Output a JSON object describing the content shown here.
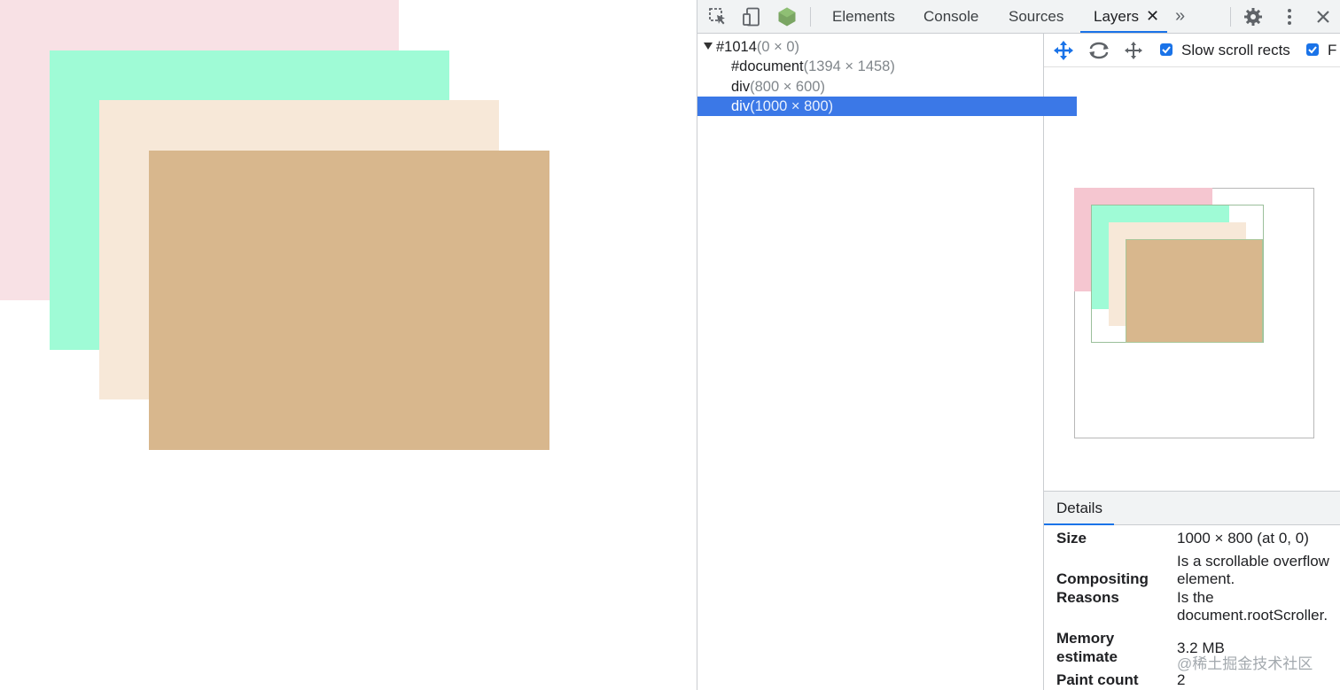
{
  "colors": {
    "box1": "#f8e1e5",
    "box2": "#9ffbd6",
    "box3": "#f7e8d8",
    "box4": "#d8b78d",
    "accent": "#1a73e8",
    "selection": "#3b78e7"
  },
  "toolbar": {
    "icons": [
      "inspect-icon",
      "device-toggle-icon",
      "vue-devtools-icon"
    ],
    "tabs": {
      "elements": "Elements",
      "console": "Console",
      "sources": "Sources",
      "layers": "Layers"
    },
    "active_tab": "Layers",
    "close_tab_glyph": "✕",
    "more_tabs_glyph": "»",
    "right_icons": [
      "settings-gear-icon",
      "more-vertical-icon",
      "close-icon"
    ]
  },
  "layer_tree": {
    "rows": [
      {
        "name": "#1014",
        "dims": "(0 × 0)",
        "expanded": true,
        "selected": false
      },
      {
        "name": "#document",
        "dims": "(1394 × 1458)",
        "selected": false
      },
      {
        "name": "div",
        "dims": "(800 × 600)",
        "selected": false
      },
      {
        "name": "div",
        "dims": "(1000 × 800)",
        "selected": true
      }
    ]
  },
  "layers_toolbar": {
    "icons": [
      "pan-mode-icon",
      "rotate-mode-icon",
      "reset-transform-icon"
    ],
    "slow_scroll_label": "Slow scroll rects",
    "slow_scroll_checked": true,
    "second_checkbox_label": "F",
    "second_checkbox_checked": true
  },
  "details": {
    "tab_label": "Details",
    "rows": {
      "size_label": "Size",
      "size_value": "1000 × 800 (at 0, 0)",
      "reasons_label_1": "Compositing",
      "reasons_label_2": "Reasons",
      "reason_1_line_1": "Is a scrollable overflow",
      "reason_1_line_2": "element.",
      "reason_2_line_1": "Is the",
      "reason_2_line_2": "document.rootScroller.",
      "memory_label_1": "Memory",
      "memory_label_2": "estimate",
      "memory_value": "3.2 MB",
      "paint_label": "Paint count",
      "paint_value": "2"
    },
    "watermark": "@稀土掘金技术社区"
  }
}
